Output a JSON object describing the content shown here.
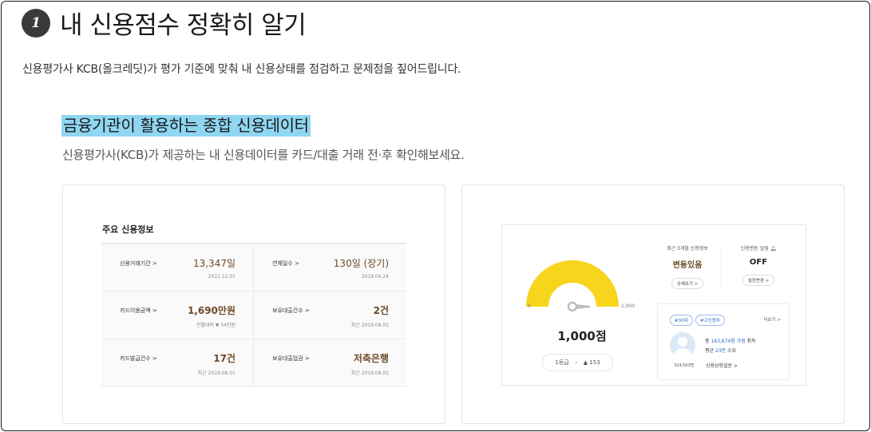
{
  "section": {
    "step_number": "1",
    "title": "내 신용점수 정확히 알기",
    "description": "신용평가사 KCB(올크레딧)가 평가 기준에 맞춰 내 신용상태를 점검하고 문제점을 짚어드립니다."
  },
  "subsection": {
    "title": "금융기관이 활용하는 종합 신용데이터",
    "description": "신용평가사(KCB)가 제공하는 내 신용데이터를 카드/대출 거래 전·후 확인해보세요."
  },
  "credit_info": {
    "title": "주요 신용정보",
    "items": [
      {
        "label": "신용거래기간 >",
        "value": "13,347일",
        "sub": "2011.12.01"
      },
      {
        "label": "연체일수 >",
        "value": "130일 (장기)",
        "sub": "2019.04.24"
      },
      {
        "label": "카드이용금액 >",
        "value": "1,690만원",
        "sub": "전월대비 ▼ 54만원"
      },
      {
        "label": "보유대출건수 >",
        "value": "2건",
        "sub": "최근 2019.08.01"
      },
      {
        "label": "카드발급건수 >",
        "value": "17건",
        "sub": "최근 2019.08.01"
      },
      {
        "label": "보유대출업권 >",
        "value": "저축은행",
        "sub": "최근 2019.08.01"
      }
    ]
  },
  "dashboard": {
    "gauge": {
      "min_label": "0",
      "max_label": "1,000",
      "score": "1,000점",
      "grade": "1등급",
      "change": "▲ 153",
      "fill_fraction": 1.0,
      "color": "#f7d51d"
    },
    "recent": {
      "label": "최근 3개월 신용정보",
      "value": "변동있음",
      "button": "상세보기 >"
    },
    "alert": {
      "label": "신용변동 알림",
      "value": "OFF",
      "button": "설정변경 >"
    },
    "profile": {
      "tag1": "#30대",
      "tag2": "#고신용자",
      "more": "더보기 >",
      "line1_prefix": "총 ",
      "line1_blue": "163,674점 가점",
      "line1_suffix": " 취득",
      "line2_prefix": "평균 ",
      "line2_blue": "23분",
      "line2_suffix": " 소요",
      "count": "324,563명",
      "link": "신용상향설문 >"
    }
  }
}
